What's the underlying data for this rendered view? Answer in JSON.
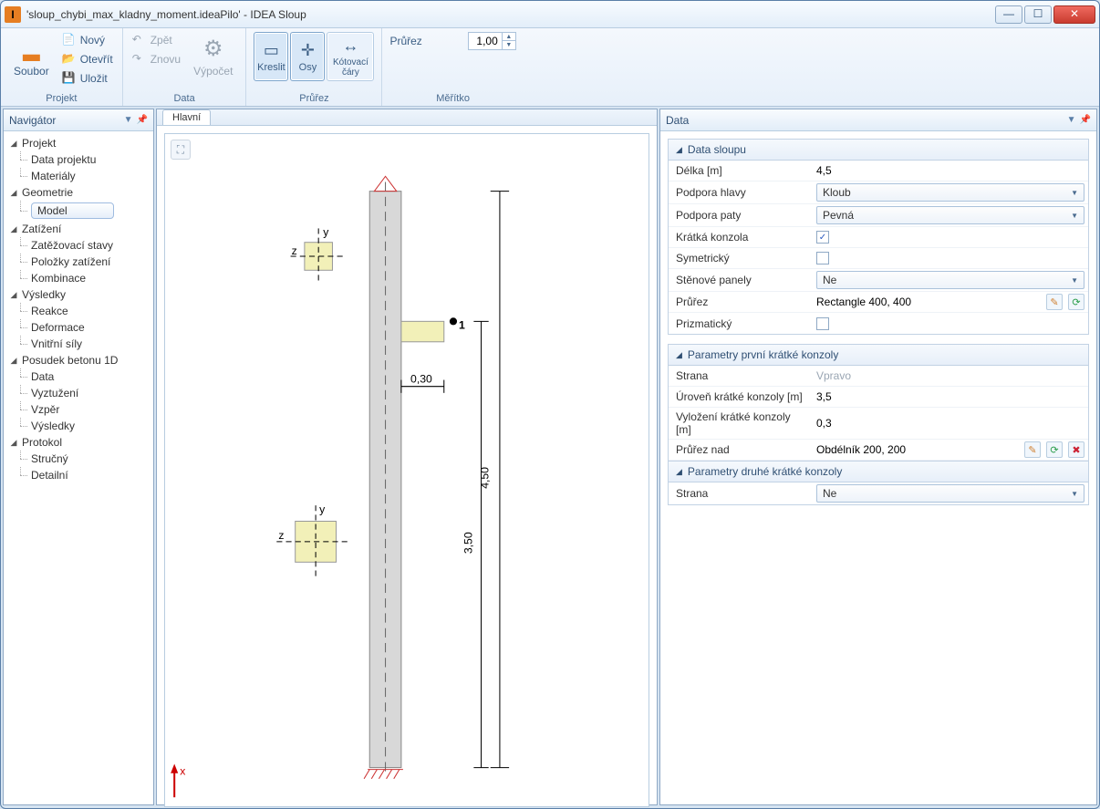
{
  "window": {
    "title": "'sloup_chybi_max_kladny_moment.ideaPilo' - IDEA Sloup"
  },
  "ribbon": {
    "soubor": "Soubor",
    "novy": "Nový",
    "otevrit": "Otevřít",
    "ulozit": "Uložit",
    "zpet": "Zpět",
    "znovu": "Znovu",
    "vypocet": "Výpočet",
    "kreslit": "Kreslit",
    "osy": "Osy",
    "kotovaci": "Kótovací\nčáry",
    "prurez_label": "Průřez",
    "prurez_value": "1,00",
    "groups": {
      "projekt": "Projekt",
      "data": "Data",
      "prurez": "Průřez",
      "meritko": "Měřítko"
    }
  },
  "navigator": {
    "title": "Navigátor",
    "projekt": "Projekt",
    "data_projektu": "Data projektu",
    "materialy": "Materiály",
    "geometrie": "Geometrie",
    "model": "Model",
    "zatizeni": "Zatížení",
    "zatezovaci_stavy": "Zatěžovací stavy",
    "polozky_zatizeni": "Položky zatížení",
    "kombinace": "Kombinace",
    "vysledky": "Výsledky",
    "reakce": "Reakce",
    "deformace": "Deformace",
    "vnitrni_sily": "Vnitřní síly",
    "posudek": "Posudek betonu 1D",
    "data": "Data",
    "vyztuzeni": "Vyztužení",
    "vzper": "Vzpěr",
    "vysledky2": "Výsledky",
    "protokol": "Protokol",
    "strucny": "Stručný",
    "detailni": "Detailní"
  },
  "center": {
    "tab": "Hlavní"
  },
  "canvas": {
    "label1": "1",
    "dim030": "0,30",
    "dim450": "4,50",
    "dim350": "3,50",
    "y": "y",
    "z": "z",
    "x": "x"
  },
  "datapanel": {
    "title": "Data",
    "section1": "Data sloupu",
    "delka_l": "Délka [m]",
    "delka_v": "4,5",
    "podpora_hlavy_l": "Podpora hlavy",
    "podpora_hlavy_v": "Kloub",
    "podpora_paty_l": "Podpora paty",
    "podpora_paty_v": "Pevná",
    "kratka_konzola_l": "Krátká konzola",
    "symetricky_l": "Symetrický",
    "stenove_panely_l": "Stěnové panely",
    "stenove_panely_v": "Ne",
    "prurez_l": "Průřez",
    "prurez_v": "Rectangle 400, 400",
    "prizmaticky_l": "Prizmatický",
    "section2": "Parametry první krátké konzoly",
    "strana_l": "Strana",
    "strana_v": "Vpravo",
    "uroven_l": "Úroveň krátké konzoly [m]",
    "uroven_v": "3,5",
    "vylozeni_l": "Vyložení krátké konzoly [m]",
    "vylozeni_v": "0,3",
    "prurez_nad_l": "Průřez nad",
    "prurez_nad_v": "Obdélník 200, 200",
    "section3": "Parametry druhé krátké konzoly",
    "strana2_l": "Strana",
    "strana2_v": "Ne"
  }
}
